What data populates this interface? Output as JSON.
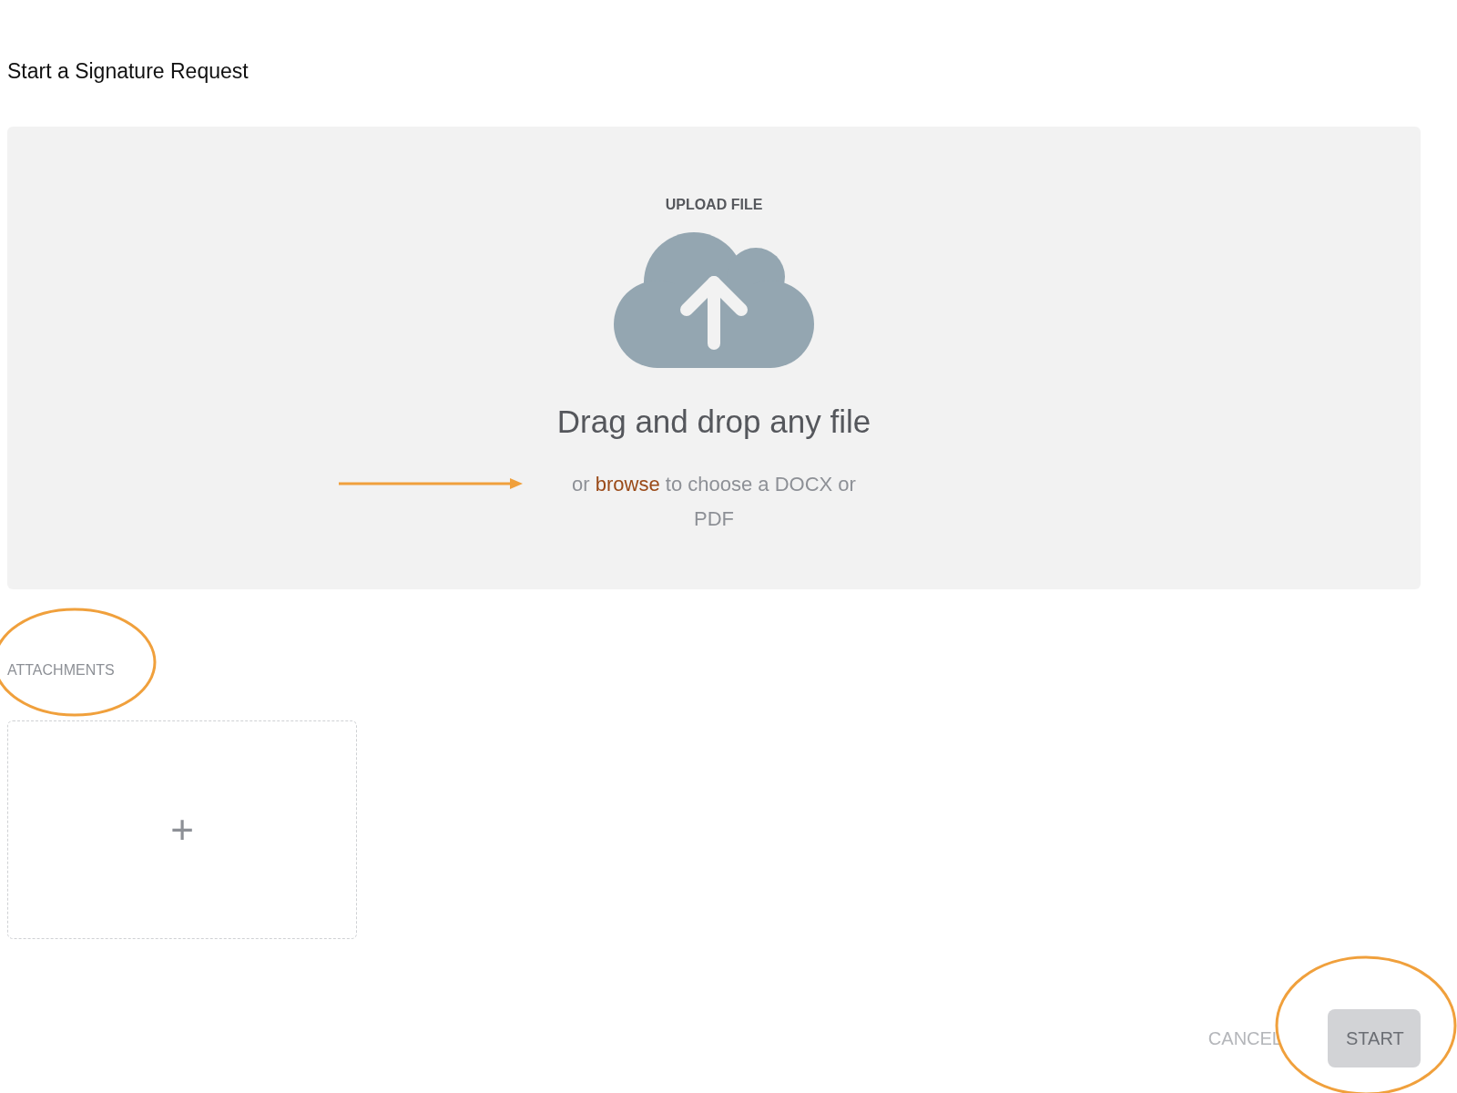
{
  "page": {
    "title": "Start a Signature Request"
  },
  "upload": {
    "heading": "UPLOAD FILE",
    "prompt": "Drag and drop any file",
    "hint_before": "or",
    "browse_link": "browse",
    "hint_after": "to choose a DOCX or PDF"
  },
  "attachments": {
    "label": "ATTACHMENTS",
    "add_symbol": "+"
  },
  "buttons": [
    {
      "label": "CANCEL",
      "kind": "text",
      "disabled": true
    },
    {
      "label": "START",
      "kind": "filled",
      "disabled": true
    }
  ]
}
